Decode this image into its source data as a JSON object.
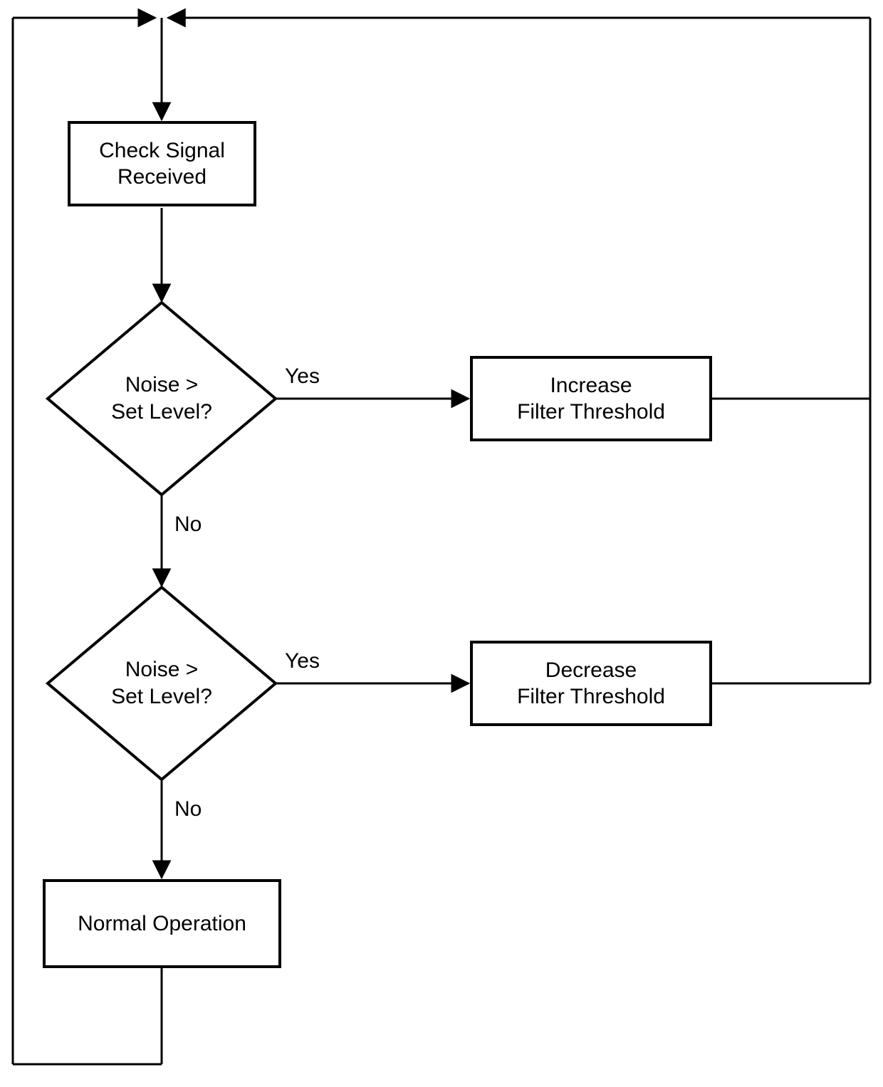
{
  "nodes": {
    "check_signal": "Check Signal\nReceived",
    "decision1": "Noise >\nSet Level?",
    "decision2": "Noise >\nSet Level?",
    "increase": "Increase\nFilter Threshold",
    "decrease": "Decrease\nFilter Threshold",
    "normal": "Normal Operation"
  },
  "edges": {
    "d1_yes": "Yes",
    "d1_no": "No",
    "d2_yes": "Yes",
    "d2_no": "No"
  }
}
